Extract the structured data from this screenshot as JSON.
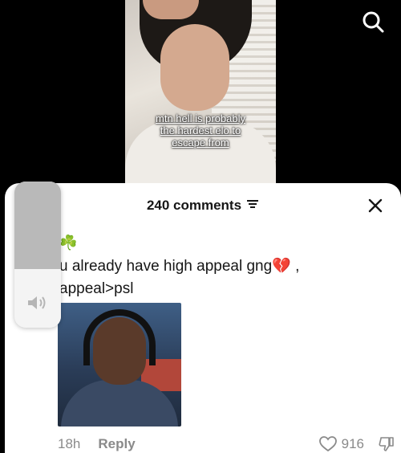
{
  "video": {
    "caption_lines": [
      "mtn hell is probably",
      "the hardest elo to",
      "escape from"
    ]
  },
  "top_bar": {
    "search_icon": "search-icon"
  },
  "comments": {
    "header_title": "240 comments",
    "sort_icon": "filter-lines-icon",
    "close_icon": "close-icon",
    "comment": {
      "emoji": "☘️",
      "line1": "u already have high appeal gng💔 ,",
      "line2": "appeal>psl",
      "time": "18h",
      "reply_label": "Reply",
      "likes": "916"
    }
  },
  "volume": {
    "level": 0.4,
    "icon": "speaker-icon"
  },
  "colors": {
    "sheet_bg": "#ffffff",
    "text": "#161616",
    "muted": "#8a8a8a"
  }
}
